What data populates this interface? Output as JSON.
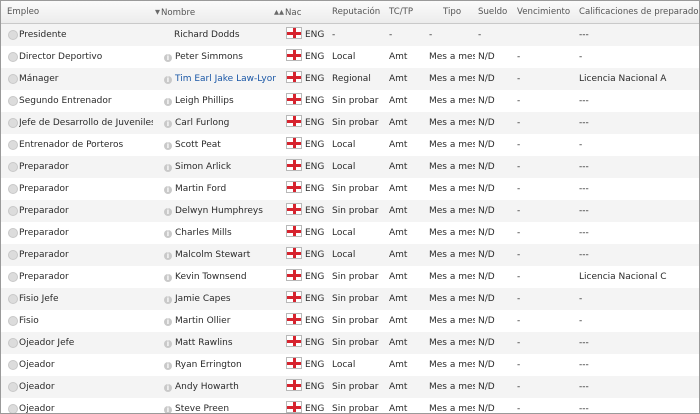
{
  "columns": {
    "empleo": "Empleo",
    "nombre": "Nombre",
    "nac": "Nac",
    "reputacion": "Reputación",
    "tctp": "TC/TP",
    "tipo": "Tipo",
    "sueldo": "Sueldo",
    "vencimiento": "Vencimiento",
    "calificaciones": "Calificaciones de preparador"
  },
  "sort_glyphs": {
    "nombre": "▼",
    "nac": "▲▲"
  },
  "rows": [
    {
      "empleo": "Presidente",
      "nombre": "Richard Dodds",
      "nac": "ENG",
      "reputacion": "-",
      "tctp": "-",
      "tipo": "-",
      "sueldo": "-",
      "vencimiento": "",
      "calificaciones": "---"
    },
    {
      "empleo": "Director Deportivo",
      "nombre": "Peter Simmons",
      "nac": "ENG",
      "reputacion": "Local",
      "tctp": "Amt",
      "tipo": "Mes a mes",
      "sueldo": "N/D",
      "vencimiento": "-",
      "calificaciones": "-"
    },
    {
      "empleo": "Mánager",
      "nombre": "Tim Earl Jake Law-Lyons",
      "nac": "ENG",
      "reputacion": "Regional",
      "tctp": "Amt",
      "tipo": "Mes a mes",
      "sueldo": "N/D",
      "vencimiento": "-",
      "calificaciones": "Licencia Nacional A"
    },
    {
      "empleo": "Segundo Entrenador",
      "nombre": "Leigh Phillips",
      "nac": "ENG",
      "reputacion": "Sin probar",
      "tctp": "Amt",
      "tipo": "Mes a mes",
      "sueldo": "N/D",
      "vencimiento": "-",
      "calificaciones": "---"
    },
    {
      "empleo": "Jefe de Desarrollo de Juveniles",
      "nombre": "Carl Furlong",
      "nac": "ENG",
      "reputacion": "Sin probar",
      "tctp": "Amt",
      "tipo": "Mes a mes",
      "sueldo": "N/D",
      "vencimiento": "-",
      "calificaciones": "---"
    },
    {
      "empleo": "Entrenador de Porteros",
      "nombre": "Scott Peat",
      "nac": "ENG",
      "reputacion": "Local",
      "tctp": "Amt",
      "tipo": "Mes a mes",
      "sueldo": "N/D",
      "vencimiento": "-",
      "calificaciones": "-"
    },
    {
      "empleo": "Preparador",
      "nombre": "Simon Arlick",
      "nac": "ENG",
      "reputacion": "Local",
      "tctp": "Amt",
      "tipo": "Mes a mes",
      "sueldo": "N/D",
      "vencimiento": "-",
      "calificaciones": "---"
    },
    {
      "empleo": "Preparador",
      "nombre": "Martin Ford",
      "nac": "ENG",
      "reputacion": "Sin probar",
      "tctp": "Amt",
      "tipo": "Mes a mes",
      "sueldo": "N/D",
      "vencimiento": "-",
      "calificaciones": "---"
    },
    {
      "empleo": "Preparador",
      "nombre": "Delwyn Humphreys",
      "nac": "ENG",
      "reputacion": "Sin probar",
      "tctp": "Amt",
      "tipo": "Mes a mes",
      "sueldo": "N/D",
      "vencimiento": "-",
      "calificaciones": "---"
    },
    {
      "empleo": "Preparador",
      "nombre": "Charles Mills",
      "nac": "ENG",
      "reputacion": "Local",
      "tctp": "Amt",
      "tipo": "Mes a mes",
      "sueldo": "N/D",
      "vencimiento": "-",
      "calificaciones": "---"
    },
    {
      "empleo": "Preparador",
      "nombre": "Malcolm Stewart",
      "nac": "ENG",
      "reputacion": "Local",
      "tctp": "Amt",
      "tipo": "Mes a mes",
      "sueldo": "N/D",
      "vencimiento": "-",
      "calificaciones": "---"
    },
    {
      "empleo": "Preparador",
      "nombre": "Kevin Townsend",
      "nac": "ENG",
      "reputacion": "Sin probar",
      "tctp": "Amt",
      "tipo": "Mes a mes",
      "sueldo": "N/D",
      "vencimiento": "-",
      "calificaciones": "Licencia Nacional C"
    },
    {
      "empleo": "Fisio Jefe",
      "nombre": "Jamie Capes",
      "nac": "ENG",
      "reputacion": "Sin probar",
      "tctp": "Amt",
      "tipo": "Mes a mes",
      "sueldo": "N/D",
      "vencimiento": "-",
      "calificaciones": "-"
    },
    {
      "empleo": "Fisio",
      "nombre": "Martin Ollier",
      "nac": "ENG",
      "reputacion": "Sin probar",
      "tctp": "Amt",
      "tipo": "Mes a mes",
      "sueldo": "N/D",
      "vencimiento": "-",
      "calificaciones": "-"
    },
    {
      "empleo": "Ojeador Jefe",
      "nombre": "Matt Rawlins",
      "nac": "ENG",
      "reputacion": "Sin probar",
      "tctp": "Amt",
      "tipo": "Mes a mes",
      "sueldo": "N/D",
      "vencimiento": "-",
      "calificaciones": "---"
    },
    {
      "empleo": "Ojeador",
      "nombre": "Ryan Errington",
      "nac": "ENG",
      "reputacion": "Local",
      "tctp": "Amt",
      "tipo": "Mes a mes",
      "sueldo": "N/D",
      "vencimiento": "-",
      "calificaciones": "---"
    },
    {
      "empleo": "Ojeador",
      "nombre": "Andy Howarth",
      "nac": "ENG",
      "reputacion": "Sin probar",
      "tctp": "Amt",
      "tipo": "Mes a mes",
      "sueldo": "N/D",
      "vencimiento": "-",
      "calificaciones": "---"
    },
    {
      "empleo": "Ojeador",
      "nombre": "Steve Preen",
      "nac": "ENG",
      "reputacion": "Sin probar",
      "tctp": "Amt",
      "tipo": "Mes a mes",
      "sueldo": "N/D",
      "vencimiento": "-",
      "calificaciones": "---"
    }
  ],
  "highlight_name_row": 2,
  "colors": {
    "link": "#1a57a6",
    "flag_red": "#d6232e",
    "row_alt": "#ffffff",
    "row_norm": "#f4f4f4"
  },
  "icons": {
    "row_select": "radio-icon",
    "info": "info-icon",
    "nationality": "england-flag-icon"
  }
}
